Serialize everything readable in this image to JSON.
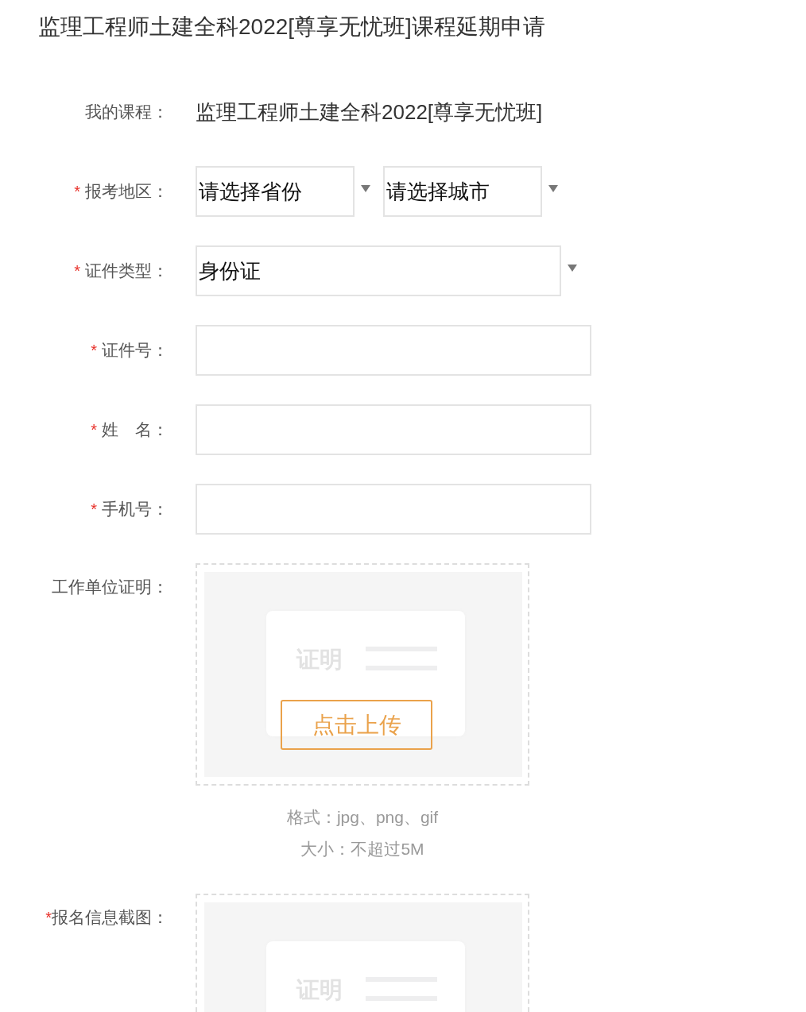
{
  "title": "监理工程师土建全科2022[尊享无忧班]课程延期申请",
  "fields": [
    {
      "kind": "display",
      "label": "我的课程：",
      "value": "监理工程师土建全科2022[尊享无忧班]"
    },
    {
      "kind": "select",
      "required_mark": "*",
      "label": "报考地区：",
      "selects": [
        {
          "value": "请选择省份"
        },
        {
          "value": "请选择城市"
        }
      ]
    },
    {
      "kind": "select",
      "required_mark": "*",
      "label": "证件类型：",
      "selects": [
        {
          "value": "身份证"
        }
      ]
    },
    {
      "kind": "input",
      "required_mark": "*",
      "label": "证件号："
    },
    {
      "kind": "input",
      "required_mark": "*",
      "label": "姓　名："
    },
    {
      "kind": "input",
      "required_mark": "*",
      "label": "手机号："
    },
    {
      "kind": "upload",
      "label": "工作单位证明：",
      "sample_text": "证明",
      "button": "点击上传",
      "hints": [
        "格式：jpg、png、gif",
        "大小：不超过5M"
      ]
    },
    {
      "kind": "upload",
      "required_mark": "*",
      "label": "报名信息截图：",
      "sample_text": "证明"
    }
  ]
}
